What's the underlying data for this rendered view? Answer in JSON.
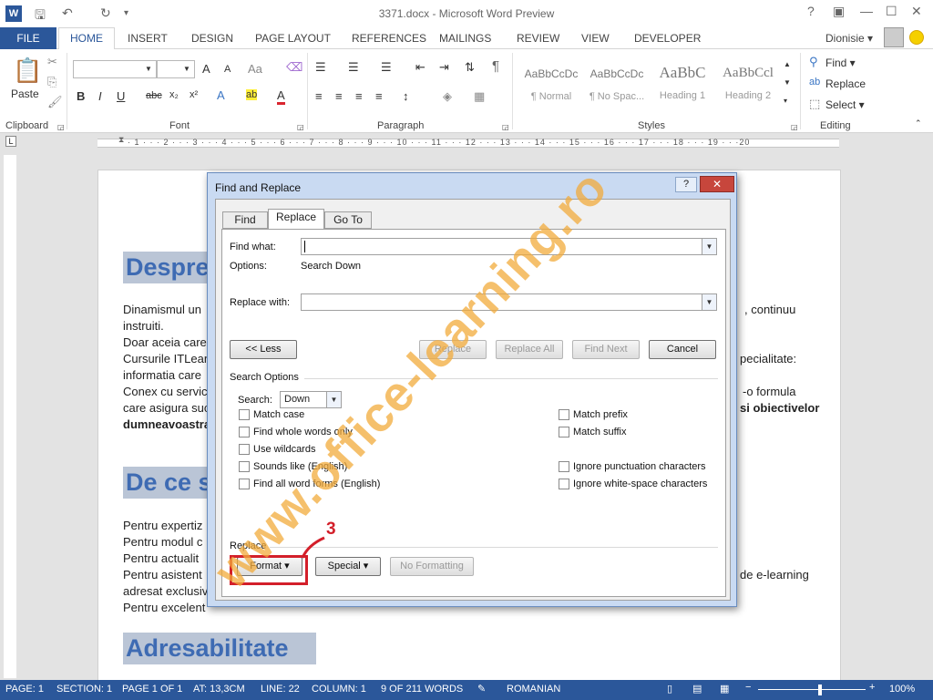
{
  "app": {
    "title": "3371.docx - Microsoft Word Preview",
    "logo": "W",
    "qat_icons": [
      "save-icon",
      "undo-icon",
      "redo-icon",
      "customize-icon"
    ],
    "window_controls": {
      "help": "?",
      "restore_ribbon": "▣",
      "minimize": "—",
      "maximize": "☐",
      "close": "✕"
    }
  },
  "ribbon_tabs": {
    "file": "FILE",
    "items": [
      "HOME",
      "INSERT",
      "DESIGN",
      "PAGE LAYOUT",
      "REFERENCES",
      "MAILINGS",
      "REVIEW",
      "VIEW",
      "DEVELOPER"
    ],
    "user": "Dionisie ▾"
  },
  "ribbon": {
    "clipboard": {
      "label": "Clipboard",
      "paste": "Paste"
    },
    "font": {
      "label": "Font",
      "grow": "A",
      "shrink": "A",
      "case": "Aa",
      "bold": "B",
      "italic": "I",
      "underline": "U",
      "strike": "abc",
      "sub": "x₂",
      "sup": "x²",
      "effects": "A",
      "highlight": "ab",
      "color": "A"
    },
    "paragraph": {
      "label": "Paragraph"
    },
    "styles": {
      "label": "Styles",
      "items": [
        {
          "preview": "AaBbCcDc",
          "name": "¶ Normal"
        },
        {
          "preview": "AaBbCcDc",
          "name": "¶ No Spac..."
        },
        {
          "preview": "AaBbC",
          "name": "Heading 1"
        },
        {
          "preview": "AaBbCcl",
          "name": "Heading 2"
        }
      ]
    },
    "editing": {
      "label": "Editing",
      "find": "Find ▾",
      "replace": "Replace",
      "select": "Select ▾"
    }
  },
  "ruler": {
    "numbers": "· 1 · · · 2 · · · 3 · · · 4 · · · 5 · · · 6 · · · 7 · · · 8 · · · 9 · · · 10 · · · 11 · · · 12 · · · 13 · · · 14 · · · 15 · · · 16 · · · 17 · · · 18 · · · 19 · · ·20"
  },
  "document": {
    "heading1": "Despre",
    "para1": [
      "Dinamismul un",
      "instruiti.",
      "Doar aceia care",
      "Cursurile ITLear",
      "informatia care",
      "Conex cu servic",
      "care asigura suc",
      "dumneavoastra"
    ],
    "para1_right": [
      ", continuu",
      "pecialitate:",
      "-o formula",
      "si obiectivelor"
    ],
    "heading2": "De ce s",
    "para2": [
      "Pentru expertiz",
      "Pentru modul c",
      "Pentru actualit",
      "Pentru asistent",
      "adresat exclusiv",
      "Pentru excelent"
    ],
    "para2_right": [
      "de e-learning"
    ],
    "heading3": "Adresabilitate"
  },
  "dialog": {
    "title": "Find and Replace",
    "help": "?",
    "close": "✕",
    "tabs": [
      "Find",
      "Replace",
      "Go To"
    ],
    "find_what_label": "Find what:",
    "find_what_value": "",
    "options_label": "Options:",
    "options_value": "Search Down",
    "replace_with_label": "Replace with:",
    "replace_with_value": "",
    "buttons": {
      "less": "<< Less",
      "replace": "Replace",
      "replace_all": "Replace All",
      "find_next": "Find Next",
      "cancel": "Cancel"
    },
    "search_options_label": "Search Options",
    "search_label": "Search:",
    "search_value": "Down",
    "checkboxes_left": [
      "Match case",
      "Find whole words only",
      "Use wildcards",
      "Sounds like (English)",
      "Find all word forms (English)"
    ],
    "checkboxes_right": [
      "Match prefix",
      "Match suffix",
      "Ignore punctuation characters",
      "Ignore white-space characters"
    ],
    "replace_section_label": "Replace",
    "format": "Format ▾",
    "special": "Special ▾",
    "no_formatting": "No Formatting"
  },
  "annotation": {
    "number": "3",
    "color": "#d31f2a"
  },
  "watermark": "www.office-learning.ro",
  "status": {
    "page": "PAGE: 1",
    "section": "SECTION: 1",
    "page_of": "PAGE 1 OF 1",
    "at": "AT: 13,3CM",
    "line": "LINE: 22",
    "column": "COLUMN: 1",
    "words": "9 OF 211 WORDS",
    "language": "ROMANIAN",
    "zoom": "100%"
  },
  "colors": {
    "accent": "#2b579a",
    "heading_text": "#3e6bb3",
    "heading_bg": "#bac5d6"
  }
}
